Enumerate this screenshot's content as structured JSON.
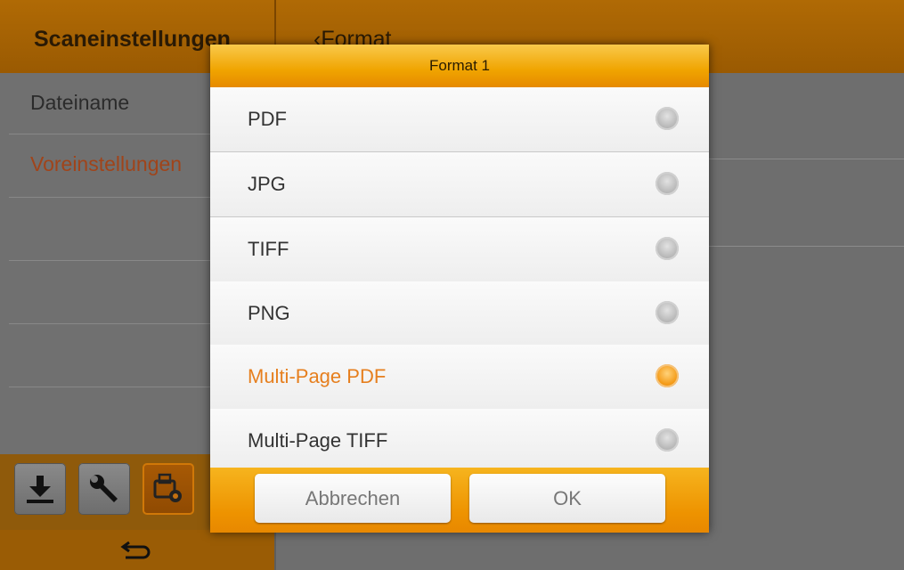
{
  "header": {
    "app_title": "Scaneinstellungen",
    "back_label": "Format"
  },
  "sidebar": {
    "items": [
      {
        "label": "Dateiname"
      },
      {
        "label": "Voreinstellungen"
      }
    ]
  },
  "toolbar": {
    "buttons": [
      {
        "icon": "download-icon"
      },
      {
        "icon": "wrench-icon"
      },
      {
        "icon": "scanner-settings-icon",
        "selected": true
      }
    ],
    "back_icon": "back-arrow-icon"
  },
  "dialog": {
    "title": "Format 1",
    "options": [
      {
        "label": "PDF",
        "selected": false
      },
      {
        "label": "JPG",
        "selected": false
      },
      {
        "label": "TIFF",
        "selected": false
      },
      {
        "label": "PNG",
        "selected": false
      },
      {
        "label": "Multi-Page PDF",
        "selected": true
      },
      {
        "label": "Multi-Page TIFF",
        "selected": false
      }
    ],
    "cancel_label": "Abbrechen",
    "ok_label": "OK"
  },
  "colors": {
    "accent": "#f29b12",
    "selected_text": "#e67f1e",
    "header_dark": "#9a5a02"
  }
}
